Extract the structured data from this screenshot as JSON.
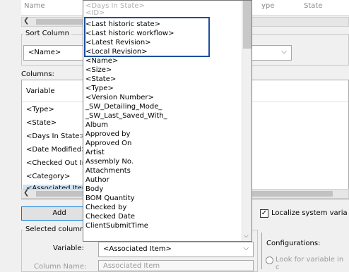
{
  "top_grid": {
    "headers": [
      "Name",
      "<ID>",
      "ype",
      "State"
    ],
    "ghost_text": "<Days In State>"
  },
  "sort": {
    "label": "Sort Column",
    "value": "<Name>"
  },
  "columns": {
    "label": "Columns:",
    "header": "Variable",
    "rows": [
      "<Type>",
      "<State>",
      "<Days In State>",
      "<Date Modified>",
      "<Checked Out In>",
      "<Category>",
      "<Associated Item>"
    ],
    "selected_index": 6
  },
  "add_label": "Add",
  "localize_label": "Localize system varia",
  "localize_checked": true,
  "selected_column": {
    "label": "Selected column",
    "variable_label": "Variable:",
    "variable_value": "<Associated Item>",
    "column_name_label": "Column Name:",
    "column_name_value": "Associated Item"
  },
  "configurations": {
    "label": "Configurations:",
    "option": "Look for variable in c"
  },
  "dropdown": {
    "items": [
      "<Last historic state>",
      "<Last historic workflow>",
      "<Latest Revision>",
      "<Local Revision>",
      "<Name>",
      "<Size>",
      "<State>",
      "<Type>",
      "<Version Number>",
      "_SW_Detailing_Mode_",
      "_SW_Last_Saved_With_",
      "Album",
      "Approved by",
      "Approved On",
      "Artist",
      "Assembly No.",
      "Attachments",
      "Author",
      "Body",
      "BOM Quantity",
      "Checked by",
      "Checked Date",
      "ClientSubmitTime"
    ]
  },
  "colors": {
    "highlight_box": "#1c4f9c",
    "selection": "#cce4f7",
    "button_border": "#0078d7"
  }
}
